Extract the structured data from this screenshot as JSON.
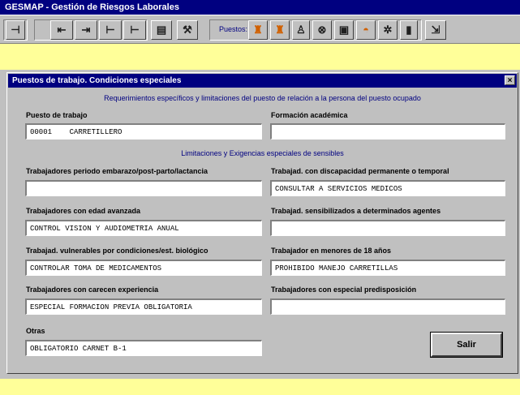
{
  "app": {
    "title": "GESMAP - Gestión de Riesgos Laborales"
  },
  "toolbar": {
    "caption": "Puestos:",
    "buttons": [
      {
        "name": "nav-first",
        "glyph": "⊣",
        "icon": "nav-first-icon"
      },
      {
        "name": "nav-prev",
        "glyph": "⇤",
        "icon": "nav-prev-icon"
      },
      {
        "name": "nav-next",
        "glyph": "⇥",
        "icon": "nav-next-icon"
      },
      {
        "name": "nav-last",
        "glyph": "⊢",
        "icon": "nav-last-icon"
      },
      {
        "name": "print",
        "glyph": "▤",
        "icon": "print-icon"
      },
      {
        "name": "tools",
        "glyph": "⚒",
        "icon": "tools-icon"
      },
      {
        "name": "worker-a",
        "glyph": "♜",
        "icon": "worker-orange-icon"
      },
      {
        "name": "worker-b",
        "glyph": "♜",
        "icon": "worker-orange-icon"
      },
      {
        "name": "person",
        "glyph": "♙",
        "icon": "person-icon"
      },
      {
        "name": "protection",
        "glyph": "⊗",
        "icon": "protection-icon"
      },
      {
        "name": "machine",
        "glyph": "▣",
        "icon": "machine-icon"
      },
      {
        "name": "helmet",
        "glyph": "◓",
        "icon": "helmet-icon"
      },
      {
        "name": "settings",
        "glyph": "✲",
        "icon": "gear-icon"
      },
      {
        "name": "extinguisher",
        "glyph": "▮",
        "icon": "extinguisher-icon"
      },
      {
        "name": "exit",
        "glyph": "⇲",
        "icon": "exit-icon"
      }
    ]
  },
  "window": {
    "title": "Puestos de trabajo. Condiciones especiales",
    "close_glyph": "×",
    "heading_top": "Requerimientos específicos y limitaciones del puesto de relación a la persona del puesto ocupado",
    "heading_mid": "Limitaciones y Exigencias especiales de sensibles",
    "fields": {
      "puesto": {
        "label": "Puesto de trabajo",
        "value": "00001    CARRETILLERO"
      },
      "formacion": {
        "label": "Formación académica",
        "value": ""
      },
      "periodo": {
        "label": "Trabajadores periodo embarazo/post-parto/lactancia",
        "value": ""
      },
      "discapacidad": {
        "label": "Trabajad. con discapacidad permanente o temporal",
        "value": "CONSULTAR A SERVICIOS MEDICOS"
      },
      "edad": {
        "label": "Trabajadores con edad avanzada",
        "value": "CONTROL VISION Y AUDIOMETRIA ANUAL"
      },
      "sensibles": {
        "label": "Trabajad. sensibilizados a determinados agentes",
        "value": ""
      },
      "vulnerables": {
        "label": "Trabajad. vulnerables por condiciones/est. biológico",
        "value": "CONTROLAR TOMA DE MEDICAMENTOS"
      },
      "menores": {
        "label": "Trabajador en menores de 18 años",
        "value": "PROHIBIDO MANEJO CARRETILLAS"
      },
      "carecen": {
        "label": "Trabajadores con carecen experiencia",
        "value": "ESPECIAL FORMACION PREVIA OBLIGATORIA"
      },
      "especial": {
        "label": "Trabajadores con especial predisposición",
        "value": ""
      },
      "otras": {
        "label": "Otras",
        "value": "OBLIGATORIO CARNET B-1"
      }
    },
    "salir_label": "Salir"
  }
}
